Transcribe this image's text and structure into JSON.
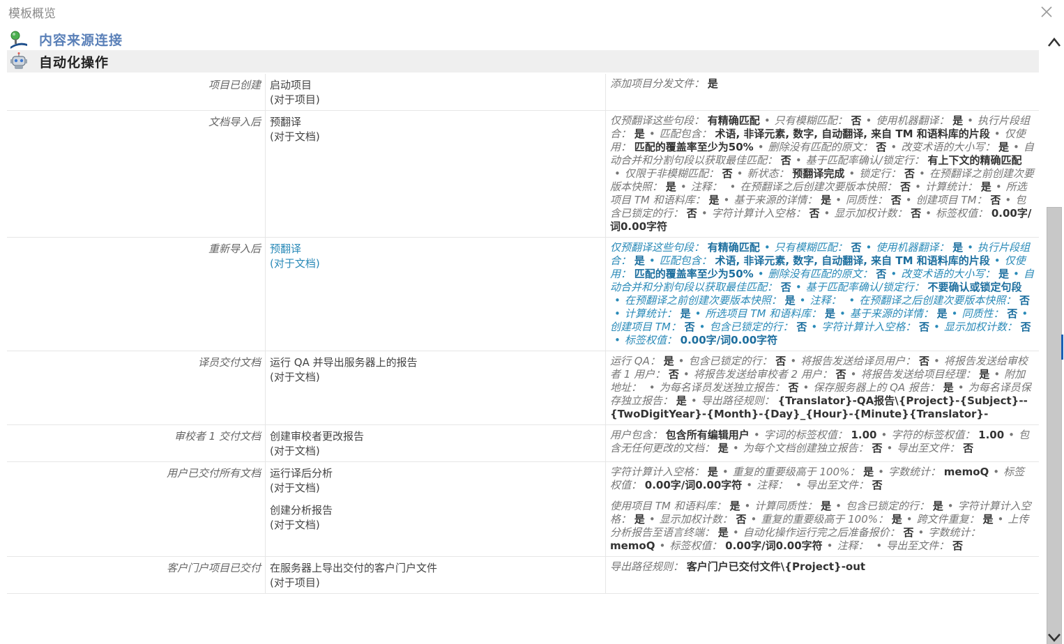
{
  "window": {
    "title": "模板概览"
  },
  "sections": {
    "content_source": "内容来源连接",
    "automation": "自动化操作"
  },
  "rows": [
    {
      "trigger": "项目已创建",
      "actions": [
        {
          "name": "启动项目",
          "scope": "(对于项目)"
        }
      ],
      "settings": [
        [
          {
            "k": "添加项目分发文件：",
            "v": "是"
          }
        ]
      ]
    },
    {
      "trigger": "文档导入后",
      "actions": [
        {
          "name": "预翻译",
          "scope": "(对于文档)"
        }
      ],
      "settings": [
        [
          {
            "k": "仅预翻译这些句段：",
            "v": "有精确匹配"
          },
          {
            "k": "只有模糊匹配：",
            "v": "否"
          },
          {
            "k": "使用机器翻译：",
            "v": "是"
          },
          {
            "k": "执行片段组合：",
            "v": "是"
          },
          {
            "k": "匹配包含：",
            "v": "术语, 非译元素, 数字, 自动翻译, 来自 TM 和语料库的片段"
          },
          {
            "k": "仅使用：",
            "v": "匹配的覆盖率至少为50%"
          },
          {
            "k": "删除没有匹配的原文：",
            "v": "否"
          },
          {
            "k": "改变术语的大小写：",
            "v": "是"
          },
          {
            "k": "自动合并和分割句段以获取最佳匹配：",
            "v": "否"
          },
          {
            "k": "基于匹配率确认/锁定行：",
            "v": "有上下文的精确匹配"
          },
          {
            "k": "仅限于非模糊匹配：",
            "v": "否"
          },
          {
            "k": "新状态：",
            "v": "预翻译完成"
          },
          {
            "k": "锁定行：",
            "v": "否"
          },
          {
            "k": "在预翻译之前创建次要版本快照：",
            "v": "是"
          },
          {
            "k": "注释：",
            "v": ""
          },
          {
            "k": "在预翻译之后创建次要版本快照：",
            "v": "否"
          },
          {
            "k": "计算统计：",
            "v": "是"
          },
          {
            "k": "所选项目 TM 和语料库：",
            "v": "是"
          },
          {
            "k": "基于来源的详情：",
            "v": "是"
          },
          {
            "k": "同质性：",
            "v": "否"
          },
          {
            "k": "创建项目 TM：",
            "v": "否"
          },
          {
            "k": "包含已锁定的行：",
            "v": "否"
          },
          {
            "k": "字符计算计入空格：",
            "v": "否"
          },
          {
            "k": "显示加权计数：",
            "v": "否"
          },
          {
            "k": "标签权值：",
            "v": "0.00字/词0.00字符"
          }
        ]
      ]
    },
    {
      "trigger": "重新导入后",
      "selected": true,
      "actions": [
        {
          "name": "预翻译",
          "scope": "(对于文档)"
        }
      ],
      "settings": [
        [
          {
            "k": "仅预翻译这些句段：",
            "v": "有精确匹配"
          },
          {
            "k": "只有模糊匹配：",
            "v": "否"
          },
          {
            "k": "使用机器翻译：",
            "v": "是"
          },
          {
            "k": "执行片段组合：",
            "v": "是"
          },
          {
            "k": "匹配包含：",
            "v": "术语, 非译元素, 数字, 自动翻译, 来自 TM 和语料库的片段"
          },
          {
            "k": "仅使用：",
            "v": "匹配的覆盖率至少为50%"
          },
          {
            "k": "删除没有匹配的原文：",
            "v": "否"
          },
          {
            "k": "改变术语的大小写：",
            "v": "是"
          },
          {
            "k": "自动合并和分割句段以获取最佳匹配：",
            "v": "否"
          },
          {
            "k": "基于匹配率确认/锁定行：",
            "v": "不要确认或锁定句段"
          },
          {
            "k": "在预翻译之前创建次要版本快照：",
            "v": "是"
          },
          {
            "k": "注释：",
            "v": ""
          },
          {
            "k": "在预翻译之后创建次要版本快照：",
            "v": "否"
          },
          {
            "k": "计算统计：",
            "v": "是"
          },
          {
            "k": "所选项目 TM 和语料库：",
            "v": "是"
          },
          {
            "k": "基于来源的详情：",
            "v": "是"
          },
          {
            "k": "同质性：",
            "v": "否"
          },
          {
            "k": "创建项目 TM：",
            "v": "否"
          },
          {
            "k": "包含已锁定的行：",
            "v": "否"
          },
          {
            "k": "字符计算计入空格：",
            "v": "否"
          },
          {
            "k": "显示加权计数：",
            "v": "否"
          },
          {
            "k": "标签权值：",
            "v": "0.00字/词0.00字符"
          }
        ]
      ]
    },
    {
      "trigger": "译员交付文档",
      "actions": [
        {
          "name": "运行 QA 并导出服务器上的报告",
          "scope": "(对于文档)"
        }
      ],
      "settings": [
        [
          {
            "k": "运行 QA：",
            "v": "是"
          },
          {
            "k": "包含已锁定的行：",
            "v": "否"
          },
          {
            "k": "将报告发送给译员用户：",
            "v": "否"
          },
          {
            "k": "将报告发送给审校者 1 用户：",
            "v": "否"
          },
          {
            "k": "将报告发送给审校者 2 用户：",
            "v": "否"
          },
          {
            "k": "将报告发送给项目经理：",
            "v": "是"
          },
          {
            "k": "附加地址：",
            "v": ""
          },
          {
            "k": "为每名译员发送独立报告：",
            "v": "否"
          },
          {
            "k": "保存服务器上的 QA 报告：",
            "v": "是"
          },
          {
            "k": "为每名译员保存独立报告：",
            "v": "是"
          },
          {
            "k": "导出路径规则：",
            "v": "{Translator}-QA报告\\{Project}-{Subject}--{TwoDigitYear}-{Month}-{Day}_{Hour}-{Minute}{Translator}-"
          }
        ]
      ]
    },
    {
      "trigger": "审校者 1 交付文档",
      "actions": [
        {
          "name": "创建审校者更改报告",
          "scope": "(对于文档)"
        }
      ],
      "settings": [
        [
          {
            "k": "用户包含：",
            "v": "包含所有编辑用户"
          },
          {
            "k": "字词的标签权值：",
            "v": "1.00"
          },
          {
            "k": "字符的标签权值：",
            "v": "1.00"
          },
          {
            "k": "包含无任何更改的文档：",
            "v": "是"
          },
          {
            "k": "为每个文档创建独立报告：",
            "v": "否"
          },
          {
            "k": "导出至文件：",
            "v": "否"
          }
        ]
      ]
    },
    {
      "trigger": "用户已交付所有文档",
      "actions": [
        {
          "name": "运行译后分析",
          "scope": "(对于文档)"
        },
        {
          "name": "创建分析报告",
          "scope": "(对于文档)"
        }
      ],
      "settings": [
        [
          {
            "k": "字符计算计入空格：",
            "v": "是"
          },
          {
            "k": "重复的重要级高于 100%：",
            "v": "是"
          },
          {
            "k": "字数统计：",
            "v": "memoQ"
          },
          {
            "k": "标签权值：",
            "v": "0.00字/词0.00字符"
          },
          {
            "k": "注释：",
            "v": ""
          },
          {
            "k": "导出至文件：",
            "v": "否"
          }
        ],
        [
          {
            "k": "使用项目 TM 和语料库：",
            "v": "是"
          },
          {
            "k": "计算同质性：",
            "v": "是"
          },
          {
            "k": "包含已锁定的行：",
            "v": "是"
          },
          {
            "k": "字符计算计入空格：",
            "v": "是"
          },
          {
            "k": "显示加权计数：",
            "v": "否"
          },
          {
            "k": "重复的重要级高于 100%：",
            "v": "是"
          },
          {
            "k": "跨文件重复：",
            "v": "是"
          },
          {
            "k": "上传分析报告至语言终端：",
            "v": "是"
          },
          {
            "k": "自动化操作运行完之后准备报价：",
            "v": "否"
          },
          {
            "k": "字数统计：",
            "v": "memoQ"
          },
          {
            "k": "标签权值：",
            "v": "0.00字/词0.00字符"
          },
          {
            "k": "注释：",
            "v": ""
          },
          {
            "k": "导出至文件：",
            "v": "否"
          }
        ]
      ]
    },
    {
      "trigger": "客户门户项目已交付",
      "actions": [
        {
          "name": "在服务器上导出交付的客户门户文件",
          "scope": "(对于项目)"
        }
      ],
      "settings": [
        [
          {
            "k": "导出路径规则：",
            "v": "客户门户已交付文件\\{Project}-out"
          }
        ]
      ]
    }
  ]
}
